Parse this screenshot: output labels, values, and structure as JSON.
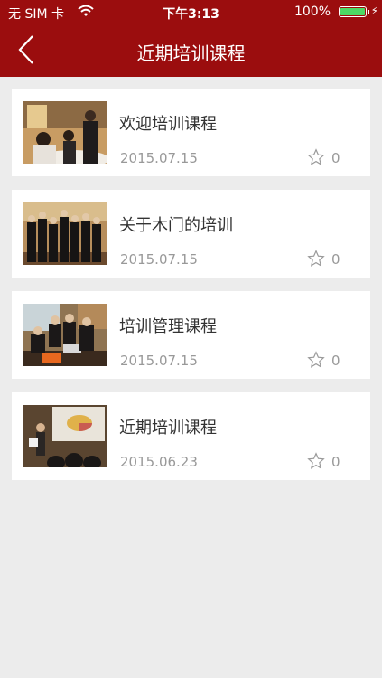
{
  "status_bar": {
    "carrier": "无 SIM 卡",
    "time": "下午3:13",
    "battery_percent": "100%",
    "battery_level": 1.0
  },
  "nav": {
    "back_icon": "chevron-left-icon",
    "title": "近期培训课程"
  },
  "courses": [
    {
      "title": "欢迎培训课程",
      "date": "2015.07.15",
      "favorites": "0"
    },
    {
      "title": "关于木门的培训",
      "date": "2015.07.15",
      "favorites": "0"
    },
    {
      "title": "培训管理课程",
      "date": "2015.07.15",
      "favorites": "0"
    },
    {
      "title": "近期培训课程",
      "date": "2015.06.23",
      "favorites": "0"
    }
  ],
  "colors": {
    "header": "#9b0d0e",
    "background": "#ececec",
    "battery": "#4cd964"
  }
}
